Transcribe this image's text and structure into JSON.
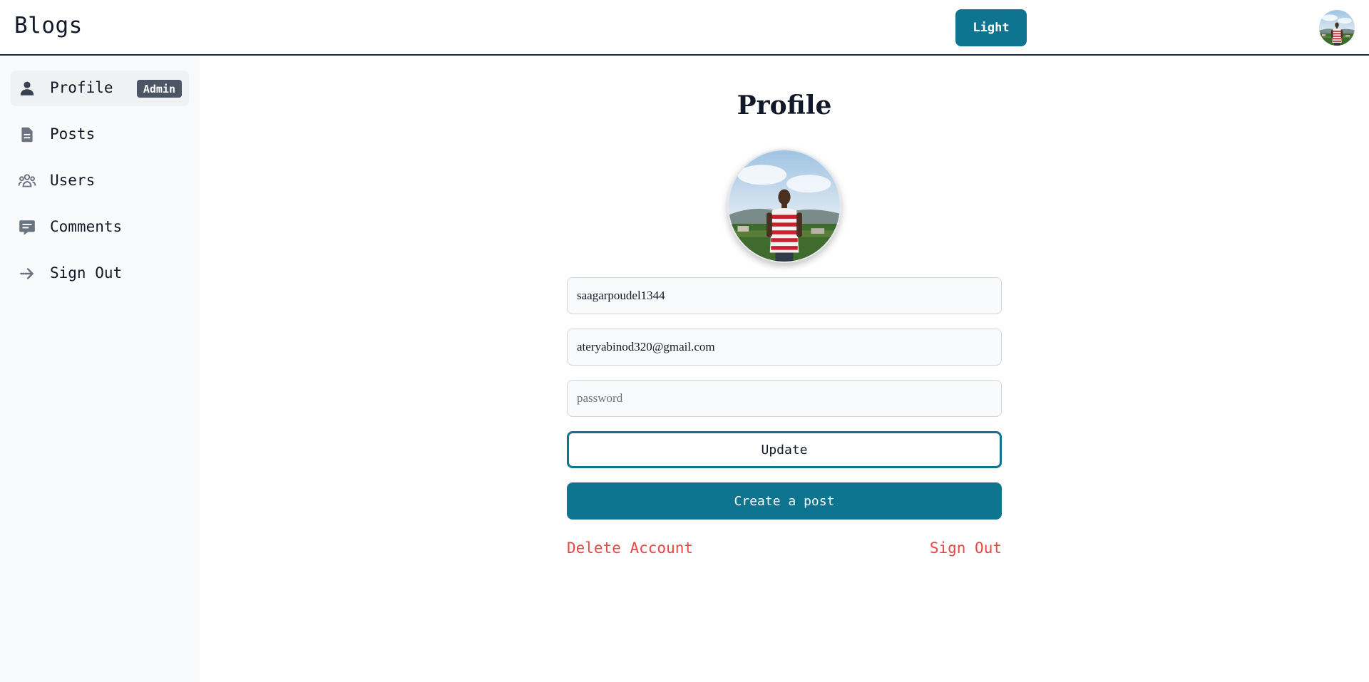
{
  "header": {
    "brand": "Blogs",
    "theme_button": "Light",
    "avatar_icon": "user-photo-avatar"
  },
  "sidebar": {
    "items": [
      {
        "label": "Profile",
        "icon": "person-icon",
        "badge": "Admin",
        "active": true
      },
      {
        "label": "Posts",
        "icon": "document-icon"
      },
      {
        "label": "Users",
        "icon": "users-group-icon"
      },
      {
        "label": "Comments",
        "icon": "comment-icon"
      },
      {
        "label": "Sign Out",
        "icon": "arrow-right-icon"
      }
    ]
  },
  "main": {
    "title": "Profile",
    "username_value": "saagarpoudel1344",
    "email_value": "ateryabinod320@gmail.com",
    "password_placeholder": "password",
    "update_label": "Update",
    "create_post_label": "Create a post",
    "delete_account_label": "Delete Account",
    "sign_out_label": "Sign Out"
  },
  "colors": {
    "accent": "#0e7490",
    "danger": "#ef4444",
    "badge": "#4b5563",
    "sidebar_bg": "#f9fafb"
  }
}
